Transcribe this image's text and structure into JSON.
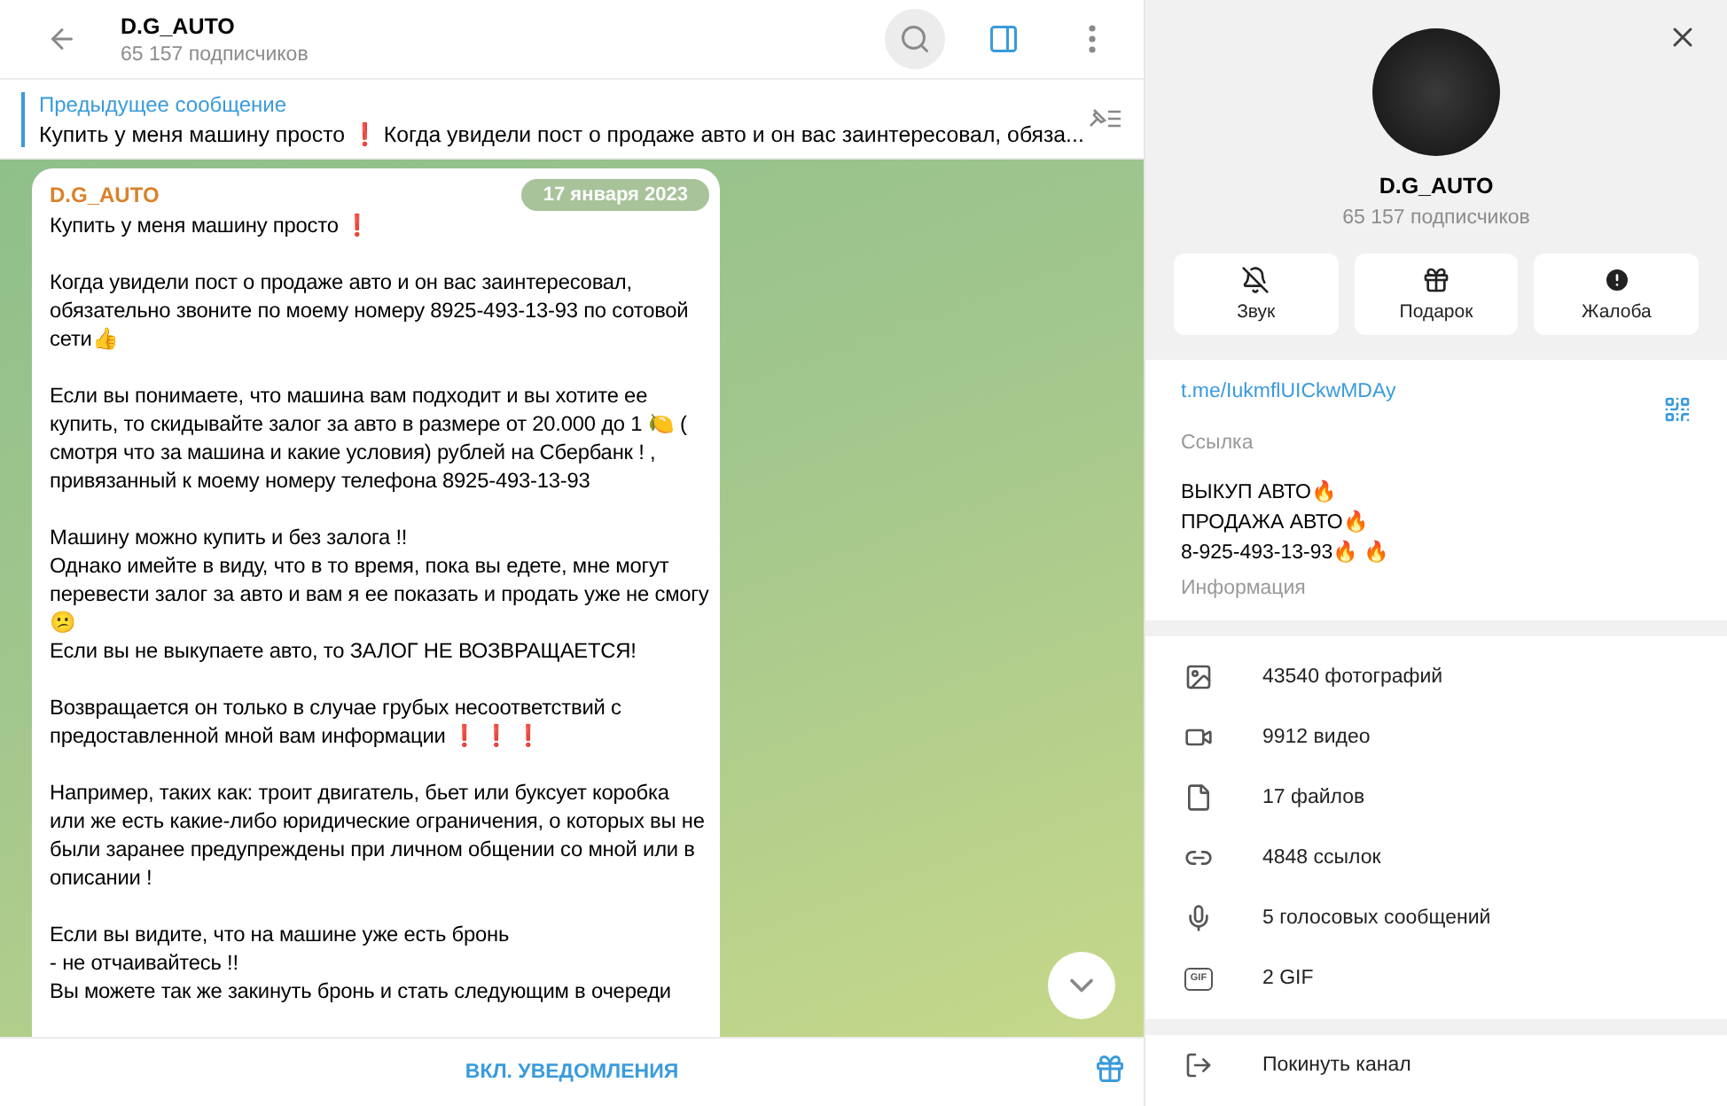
{
  "header": {
    "title": "D.G_AUTO",
    "subtitle": "65 157 подписчиков"
  },
  "pinned": {
    "label": "Предыдущее сообщение",
    "text": "Купить у меня машину просто ❗  Когда увидели пост о продаже авто и он вас заинтересовал, обяза..."
  },
  "message": {
    "author": "D.G_AUTO",
    "date": "17 января 2023",
    "paragraphs": [
      "Купить у меня машину просто ❗",
      "Когда увидели пост о продаже авто и он вас заинтересовал, обязательно звоните по моему номеру 8925-493-13-93 по сотовой сети👍",
      "Если вы понимаете, что машина вам подходит и вы хотите ее купить, то скидывайте залог за авто в размере от 20.000 до 1 🍋 ( смотря что за машина и какие условия) рублей на Сбербанк ! , привязанный к моему номеру телефона 8925-493-13-93",
      "Машину можно купить и без залога !!\nОднако имейте в виду, что в то время, пока вы едете, мне могут перевести залог за авто и вам я ее показать и продать уже не смогу😕\nЕсли вы не выкупаете авто, то ЗАЛОГ НЕ ВОЗВРАЩАЕТСЯ!",
      "Возвращается он только в случае грубых несоответствий с предоставленной мной вам информации  ❗ ❗ ❗",
      "Например, таких как: троит двигатель, бьет или буксует коробка или же есть какие-либо юридические ограничения, о которых вы не были заранее предупреждены при личном общении со мной или в описании !\n ",
      "Если вы видите, что на машине уже есть бронь\n- не отчаивайтесь !!\nВы можете так же закинуть бронь и стать следующим в очереди"
    ]
  },
  "bottom_bar": {
    "button": "ВКЛ. УВЕДОМЛЕНИЯ"
  },
  "profile": {
    "name": "D.G_AUTO",
    "subtitle": "65 157 подписчиков",
    "actions": [
      {
        "kind": "mute",
        "label": "Звук"
      },
      {
        "kind": "gift",
        "label": "Подарок"
      },
      {
        "kind": "report",
        "label": "Жалоба"
      }
    ],
    "link": "t.me/IukmflUICkwMDAy",
    "link_caption": "Ссылка",
    "info_lines": [
      "ВЫКУП АВТО🔥",
      "ПРОДАЖА АВТО🔥",
      "8-925-493-13-93🔥 🔥"
    ],
    "info_caption": "Информация",
    "media": [
      {
        "kind": "photo",
        "label": "43540 фотографий"
      },
      {
        "kind": "video",
        "label": "9912 видео"
      },
      {
        "kind": "file",
        "label": "17 файлов"
      },
      {
        "kind": "link",
        "label": "4848 ссылок"
      },
      {
        "kind": "voice",
        "label": "5 голосовых сообщений"
      },
      {
        "kind": "gif",
        "label": "2 GIF",
        "icon_text": "GIF"
      }
    ],
    "leave": "Покинуть канал"
  }
}
